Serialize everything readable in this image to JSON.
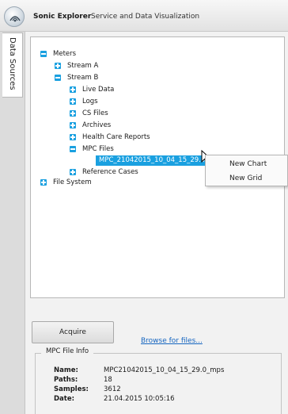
{
  "window": {
    "title_app": "Sonic Explorer",
    "title_sub": "Service and Data Visualization"
  },
  "sidebar": {
    "tab_label": "Data Sources"
  },
  "tree": {
    "meters": "Meters",
    "stream_a": "Stream A",
    "stream_b": "Stream B",
    "live_data": "Live Data",
    "logs": "Logs",
    "cs_files": "CS Files",
    "archives": "Archives",
    "health_care_reports": "Health Care Reports",
    "mpc_files": "MPC Files",
    "selected_file": "MPC_21042015_10_04_15_29.0_mps",
    "reference_cases": "Reference Cases",
    "file_system": "File System"
  },
  "context_menu": {
    "new_chart": "New Chart",
    "new_grid": "New Grid"
  },
  "browse_link": "Browse for files...",
  "acquire_button": "Acquire",
  "file_info": {
    "legend": "MPC File Info",
    "name_label": "Name:",
    "name_value": "MPC21042015_10_04_15_29.0_mps",
    "paths_label": "Paths:",
    "paths_value": "18",
    "samples_label": "Samples:",
    "samples_value": "3612",
    "date_label": "Date:",
    "date_value": "21.04.2015 10:05:16"
  },
  "colors": {
    "accent": "#1aa0e0",
    "link": "#1565c0"
  },
  "icons": {
    "app": "sonic-explorer-logo-icon",
    "expander": "expand-collapse-icon",
    "cursor": "mouse-pointer-icon"
  }
}
